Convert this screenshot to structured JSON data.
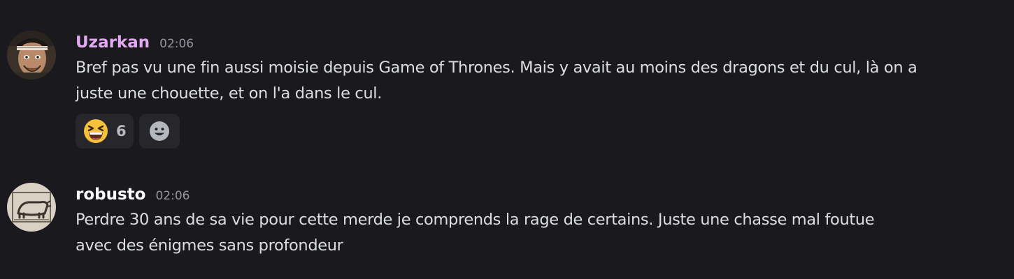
{
  "messages": [
    {
      "username": "Uzarkan",
      "username_color": "#e3a9f2",
      "time": "02:06",
      "text_lines": [
        "Bref pas vu une fin aussi moisie depuis Game of Thrones. Mais y avait au moins des dragons et du cul, là on a",
        "juste une chouette, et on l'a dans le cul."
      ],
      "reactions": [
        {
          "emoji": "laughing-face-icon",
          "count": "6"
        }
      ],
      "add_reaction_icon": "add-reaction-smiley-icon"
    },
    {
      "username": "robusto",
      "username_color": "#ffffff",
      "time": "02:06",
      "text_lines": [
        "Perdre 30 ans de sa vie pour cette merde je comprends la rage de certains. Juste une chasse mal foutue",
        "avec des énigmes sans profondeur"
      ]
    }
  ],
  "colors": {
    "background": "#1a1a1e",
    "text": "#dbdee1",
    "timestamp": "#94969c",
    "reaction_bg": "#26262b"
  }
}
